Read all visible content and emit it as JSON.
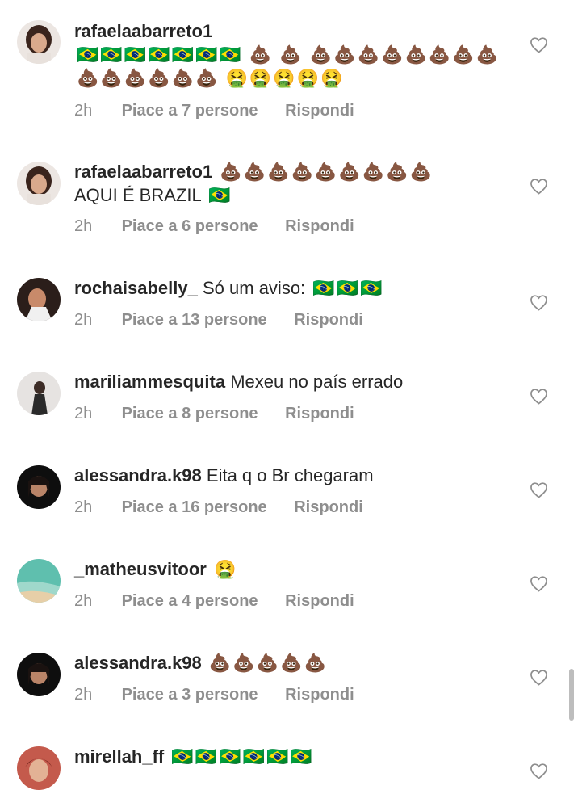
{
  "comments": [
    {
      "username": "rafaelaabarreto1",
      "text": "",
      "emoji": "🇧🇷🇧🇷🇧🇷🇧🇷🇧🇷🇧🇷🇧🇷 💩 💩 💩💩💩💩💩💩💩💩💩💩💩💩💩💩 🤮🤮🤮🤮🤮",
      "time": "2h",
      "likes": "Piace a 7 persone",
      "reply": "Rispondi",
      "avatar_color": "#5a3a2e"
    },
    {
      "username": "rafaelaabarreto1",
      "text": "AQUI É BRAZIL",
      "emoji_before": "💩💩💩💩💩💩💩💩💩",
      "emoji": "🇧🇷",
      "time": "2h",
      "likes": "Piace a 6 persone",
      "reply": "Rispondi",
      "avatar_color": "#5a3a2e"
    },
    {
      "username": "rochaisabelly_",
      "text": "Só um aviso:",
      "emoji": "🇧🇷🇧🇷🇧🇷",
      "time": "2h",
      "likes": "Piace a 13 persone",
      "reply": "Rispondi",
      "avatar_color": "#3b2a24"
    },
    {
      "username": "mariliammesquita",
      "text": "Mexeu no país errado",
      "emoji": "",
      "time": "2h",
      "likes": "Piace a 8 persone",
      "reply": "Rispondi",
      "avatar_color": "#c9c4c0"
    },
    {
      "username": "alessandra.k98",
      "text": "Eita q o Br chegaram",
      "emoji": "",
      "time": "2h",
      "likes": "Piace a 16 persone",
      "reply": "Rispondi",
      "avatar_color": "#111111"
    },
    {
      "username": "_matheusvitoor",
      "text": "",
      "emoji": "🤮",
      "time": "2h",
      "likes": "Piace a 4 persone",
      "reply": "Rispondi",
      "avatar_color": "#6fc2b3"
    },
    {
      "username": "alessandra.k98",
      "text": "",
      "emoji": "💩💩💩💩💩",
      "time": "2h",
      "likes": "Piace a 3 persone",
      "reply": "Rispondi",
      "avatar_color": "#111111"
    },
    {
      "username": "mirellah_ff",
      "text": "",
      "emoji": "🇧🇷🇧🇷🇧🇷🇧🇷🇧🇷🇧🇷",
      "time": "",
      "likes": "",
      "reply": "",
      "avatar_color": "#b2473e"
    }
  ]
}
